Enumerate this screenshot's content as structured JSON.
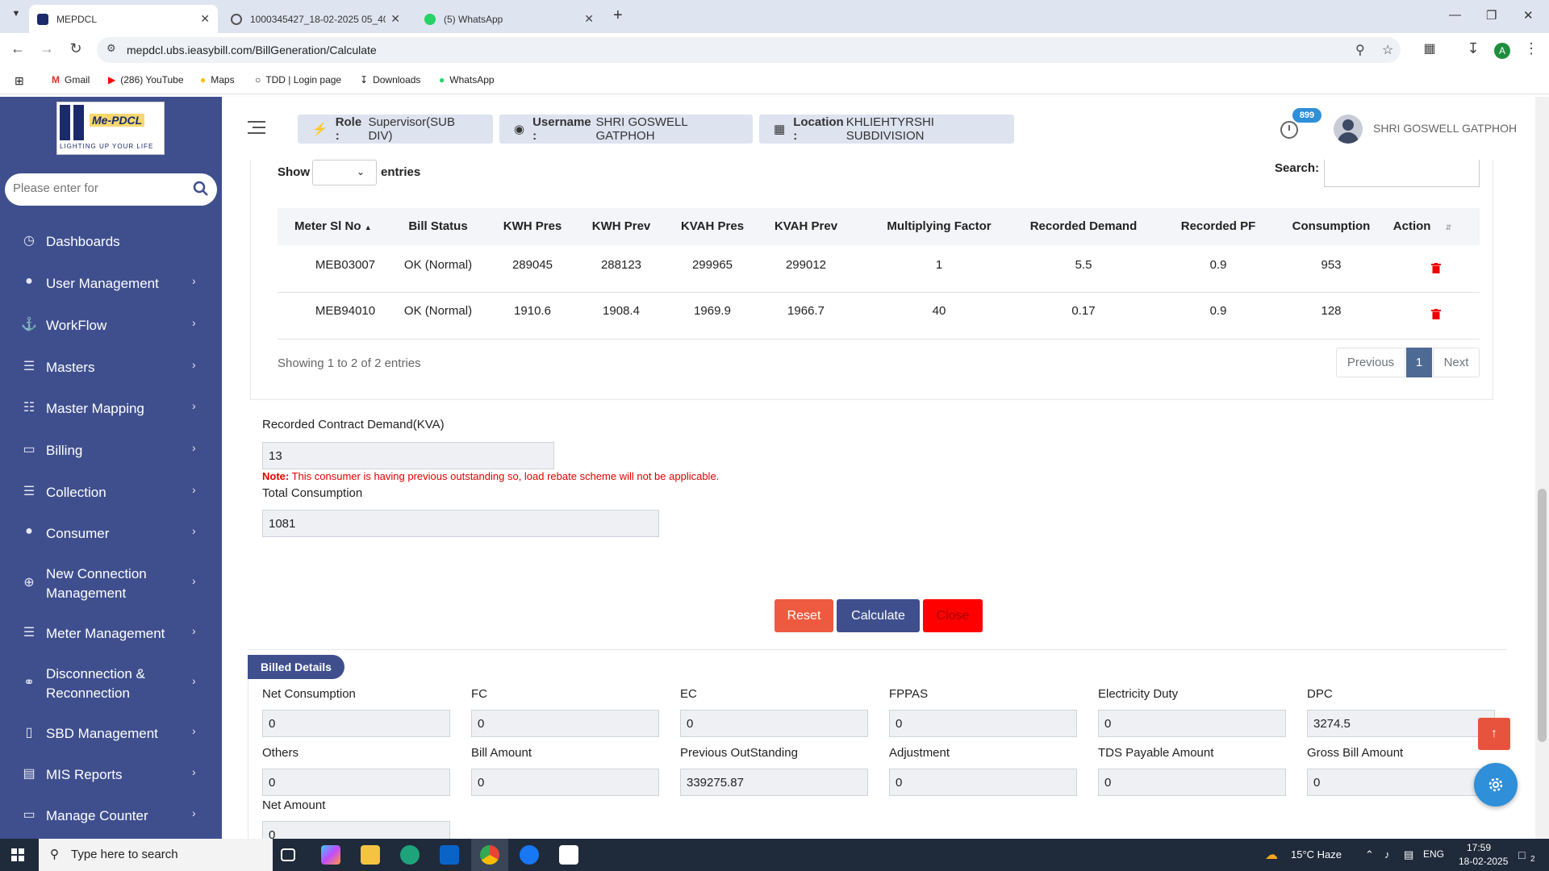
{
  "browser": {
    "tabs": [
      {
        "title": "MEPDCL",
        "active": true
      },
      {
        "title": "1000345427_18-02-2025 05_40",
        "active": false
      },
      {
        "title": "(5) WhatsApp",
        "active": false
      }
    ],
    "url": "mepdcl.ubs.ieasybill.com/BillGeneration/Calculate",
    "profile_initial": "A",
    "bookmarks": [
      "Gmail",
      "(286) YouTube",
      "Maps",
      "TDD | Login page",
      "Downloads",
      "WhatsApp"
    ]
  },
  "sidebar": {
    "logo_name": "Me-PDCL",
    "logo_tagline": "LIGHTING UP YOUR LIFE",
    "search_placeholder": "Please enter for",
    "items": [
      {
        "label": "Dashboards",
        "icon": "dashboard-icon",
        "has_children": false
      },
      {
        "label": "User Management",
        "icon": "user-icon",
        "has_children": true
      },
      {
        "label": "WorkFlow",
        "icon": "anchor-icon",
        "has_children": true
      },
      {
        "label": "Masters",
        "icon": "server-icon",
        "has_children": true
      },
      {
        "label": "Master Mapping",
        "icon": "sitemap-icon",
        "has_children": true
      },
      {
        "label": "Billing",
        "icon": "monitor-icon",
        "has_children": true
      },
      {
        "label": "Collection",
        "icon": "list-icon",
        "has_children": true
      },
      {
        "label": "Consumer",
        "icon": "user-icon",
        "has_children": true
      },
      {
        "label": "New Connection",
        "label2": "Management",
        "icon": "plus-circle-icon",
        "has_children": true
      },
      {
        "label": "Meter Management",
        "icon": "list-icon",
        "has_children": true
      },
      {
        "label": "Disconnection &",
        "label2": "Reconnection",
        "icon": "link-icon",
        "has_children": true
      },
      {
        "label": "SBD Management",
        "icon": "mobile-icon",
        "has_children": true
      },
      {
        "label": "MIS Reports",
        "icon": "bar-chart-icon",
        "has_children": true
      },
      {
        "label": "Manage Counter",
        "icon": "counter-icon",
        "has_children": true
      }
    ]
  },
  "header": {
    "role_label": "Role :",
    "role_value": "Supervisor(SUB DIV)",
    "username_label": "Username :",
    "username_value": "SHRI GOSWELL GATPHOH",
    "location_label": "Location :",
    "location_value": "KHLIEHTYRSHI SUBDIVISION",
    "notification_count": "899",
    "user_name": "SHRI GOSWELL GATPHOH"
  },
  "table": {
    "show_label": "Show",
    "entries_label": "entries",
    "search_label": "Search:",
    "columns": [
      "Meter Sl No",
      "Bill Status",
      "KWH Pres",
      "KWH Prev",
      "KVAH Pres",
      "KVAH Prev",
      "Multiplying Factor",
      "Recorded Demand",
      "Recorded PF",
      "Consumption",
      "Action"
    ],
    "rows": [
      [
        "MEB03007",
        "OK (Normal)",
        "289045",
        "288123",
        "299965",
        "299012",
        "1",
        "5.5",
        "0.9",
        "953"
      ],
      [
        "MEB94010",
        "OK (Normal)",
        "1910.6",
        "1908.4",
        "1969.9",
        "1966.7",
        "40",
        "0.17",
        "0.9",
        "128"
      ]
    ],
    "info": "Showing 1 to 2 of 2 entries",
    "pagination": {
      "previous": "Previous",
      "current": "1",
      "next": "Next"
    }
  },
  "form": {
    "contract_demand_label": "Recorded Contract Demand(KVA)",
    "contract_demand_value": "13",
    "note_prefix": "Note:",
    "note_text": " This consumer is having previous outstanding so, load rebate scheme will not be applicable.",
    "total_consumption_label": "Total Consumption",
    "total_consumption_value": "1081",
    "buttons": {
      "reset": "Reset",
      "calculate": "Calculate",
      "close": "Close"
    }
  },
  "billed": {
    "title": "Billed Details",
    "fields": [
      {
        "label": "Net Consumption",
        "value": "0"
      },
      {
        "label": "FC",
        "value": "0"
      },
      {
        "label": "EC",
        "value": "0"
      },
      {
        "label": "FPPAS",
        "value": "0"
      },
      {
        "label": "Electricity Duty",
        "value": "0"
      },
      {
        "label": "DPC",
        "value": "3274.5"
      },
      {
        "label": "Others",
        "value": "0"
      },
      {
        "label": "Bill Amount",
        "value": "0"
      },
      {
        "label": "Previous OutStanding",
        "value": "339275.87"
      },
      {
        "label": "Adjustment",
        "value": "0"
      },
      {
        "label": "TDS Payable Amount",
        "value": "0"
      },
      {
        "label": "Gross Bill Amount",
        "value": "0"
      },
      {
        "label": "Net Amount",
        "value": "0"
      }
    ]
  },
  "taskbar": {
    "search_placeholder": "Type here to search",
    "weather": "15°C  Haze",
    "language": "ENG",
    "time": "17:59",
    "date": "18-02-2025",
    "notification_count": "2"
  },
  "colors": {
    "sidebar": "#3f4f8e",
    "reset": "#ee5a3f",
    "calculate": "#3f4f8e",
    "close": "#ff0000",
    "note": "#e00000"
  }
}
